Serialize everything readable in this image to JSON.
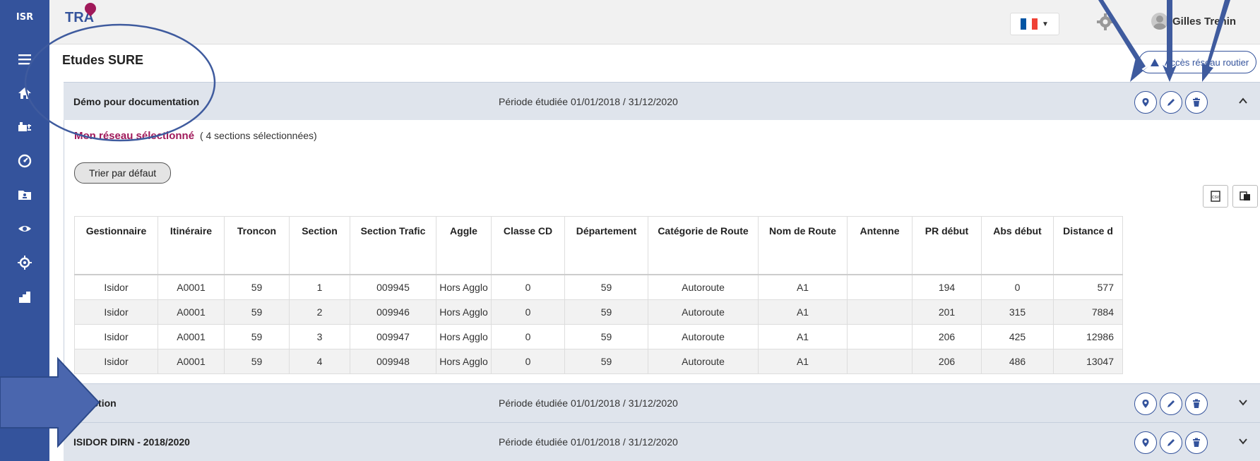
{
  "sidebar": {
    "logo": "ISR",
    "items": [
      {
        "icon": "menu-icon"
      },
      {
        "icon": "home-icon"
      },
      {
        "icon": "network-icon"
      },
      {
        "icon": "speedometer-icon"
      },
      {
        "icon": "folder-user-icon"
      },
      {
        "icon": "eye-icon"
      },
      {
        "icon": "target-icon"
      },
      {
        "icon": "stairs-icon"
      }
    ]
  },
  "header": {
    "brand": "TRA",
    "language_flag_colors": [
      "#0055a4",
      "#ffffff",
      "#ef4135"
    ],
    "user_name": "Gilles Trenin"
  },
  "page": {
    "title": "Etudes SURE",
    "road_access_label": "Accès réseau routier"
  },
  "studies": [
    {
      "name": "Démo pour documentation",
      "period": "Période étudiée 01/01/2018 / 31/12/2020",
      "expanded": true
    },
    {
      "name": "sélection",
      "period": "Période étudiée 01/01/2018 / 31/12/2020",
      "expanded": false
    },
    {
      "name": "ISIDOR DIRN - 2018/2020",
      "period": "Période étudiée 01/01/2018 / 31/12/2020",
      "expanded": false
    }
  ],
  "network": {
    "title": "Mon réseau sélectionné",
    "count_text": "( 4 sections sélectionnées)",
    "sort_label": "Trier par défaut"
  },
  "table": {
    "headers": [
      "Gestionnaire",
      "Itinéraire",
      "Troncon",
      "Section",
      "Section Trafic",
      "Aggle",
      "Classe CD",
      "Département",
      "Catégorie de Route",
      "Nom de Route",
      "Antenne",
      "PR début",
      "Abs début",
      "Distance d"
    ],
    "rows": [
      [
        "Isidor",
        "A0001",
        "59",
        "1",
        "009945",
        "Hors Agglo",
        "0",
        "59",
        "Autoroute",
        "A1",
        "",
        "194",
        "0",
        "577"
      ],
      [
        "Isidor",
        "A0001",
        "59",
        "2",
        "009946",
        "Hors Agglo",
        "0",
        "59",
        "Autoroute",
        "A1",
        "",
        "201",
        "315",
        "7884"
      ],
      [
        "Isidor",
        "A0001",
        "59",
        "3",
        "009947",
        "Hors Agglo",
        "0",
        "59",
        "Autoroute",
        "A1",
        "",
        "206",
        "425",
        "12986"
      ],
      [
        "Isidor",
        "A0001",
        "59",
        "4",
        "009948",
        "Hors Agglo",
        "0",
        "59",
        "Autoroute",
        "A1",
        "",
        "206",
        "486",
        "13047"
      ]
    ]
  },
  "colors": {
    "sidebar": "#34539c",
    "accent": "#a0195a",
    "annotation": "#3f5b9e"
  }
}
